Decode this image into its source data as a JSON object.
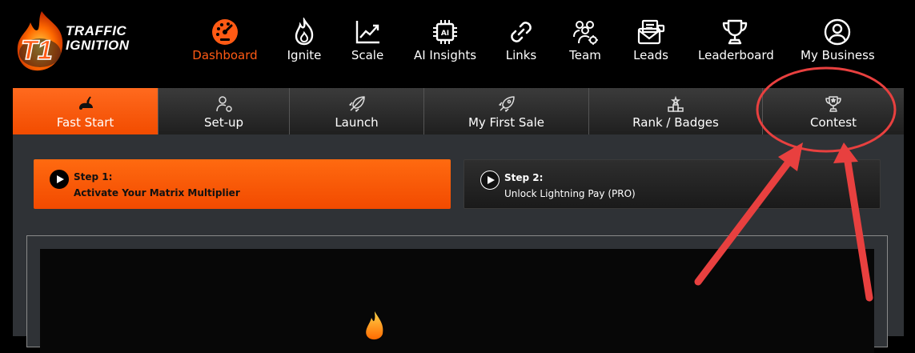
{
  "brand": {
    "line1": "TRAFFIC",
    "line2": "IGNITION",
    "badge": "T1"
  },
  "nav": {
    "items": [
      {
        "label": "Dashboard",
        "icon": "dashboard-gauge-icon"
      },
      {
        "label": "Ignite",
        "icon": "flame-icon"
      },
      {
        "label": "Scale",
        "icon": "chart-line-icon"
      },
      {
        "label": "AI Insights",
        "icon": "ai-chip-icon"
      },
      {
        "label": "Links",
        "icon": "link-icon"
      },
      {
        "label": "Team",
        "icon": "team-icon"
      },
      {
        "label": "Leads",
        "icon": "mail-icon"
      },
      {
        "label": "Leaderboard",
        "icon": "trophy-icon"
      },
      {
        "label": "My Business",
        "icon": "user-circle-icon"
      }
    ],
    "active": "Dashboard"
  },
  "tabs": {
    "items": [
      {
        "label": "Fast Start",
        "icon": "rabbit-icon"
      },
      {
        "label": "Set-up",
        "icon": "user-gear-icon"
      },
      {
        "label": "Launch",
        "icon": "rocket-icon"
      },
      {
        "label": "My First Sale",
        "icon": "rocket-icon"
      },
      {
        "label": "Rank / Badges",
        "icon": "podium-icon"
      },
      {
        "label": "Contest",
        "icon": "trophy-icon"
      }
    ],
    "active": "Fast Start"
  },
  "steps": [
    {
      "title": "Step 1:",
      "text": "Activate Your Matrix Multiplier"
    },
    {
      "title": "Step 2:",
      "text": "Unlock Lightning Pay (PRO)"
    }
  ],
  "colors": {
    "accent": "#ff5a14",
    "annotation": "#e8403f",
    "panel": "#2f3236"
  }
}
